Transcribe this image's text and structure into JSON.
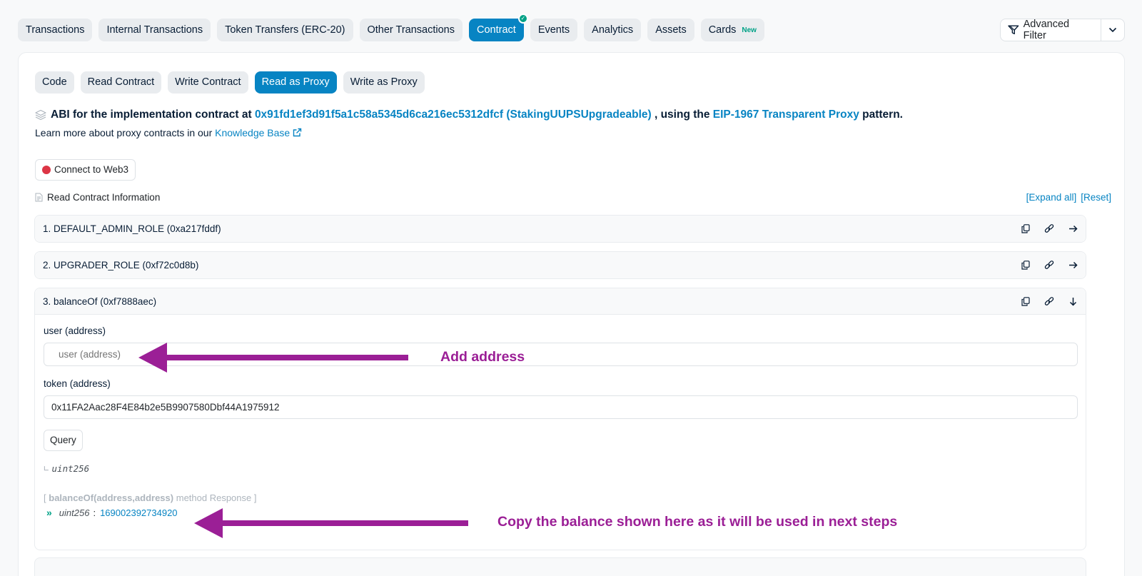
{
  "top_tabs": [
    {
      "label": "Transactions"
    },
    {
      "label": "Internal Transactions"
    },
    {
      "label": "Token Transfers (ERC-20)"
    },
    {
      "label": "Other Transactions"
    },
    {
      "label": "Contract"
    },
    {
      "label": "Events"
    },
    {
      "label": "Analytics"
    },
    {
      "label": "Assets"
    },
    {
      "label": "Cards",
      "badge": "New"
    }
  ],
  "advanced_filter": {
    "label": "Advanced Filter"
  },
  "sub_tabs": [
    {
      "label": "Code"
    },
    {
      "label": "Read Contract"
    },
    {
      "label": "Write Contract"
    },
    {
      "label": "Read as Proxy"
    },
    {
      "label": "Write as Proxy"
    }
  ],
  "abi": {
    "prefix": "ABI for the implementation contract at",
    "address_link": "0x91fd1ef3d91f5a1c58a5345d6ca216ec5312dfcf (StakingUUPSUpgradeable)",
    "middle": ", using the",
    "pattern_link": "EIP-1967 Transparent Proxy",
    "suffix": "pattern."
  },
  "learn": {
    "prefix": "Learn more about proxy contracts in our",
    "link": "Knowledge Base"
  },
  "connect_button": "Connect to Web3",
  "read_info_label": "Read Contract Information",
  "expand_all": "[Expand all]",
  "reset": "[Reset]",
  "functions": [
    {
      "title": "1. DEFAULT_ADMIN_ROLE (0xa217fddf)"
    },
    {
      "title": "2. UPGRADER_ROLE (0xf72c0d8b)"
    },
    {
      "title": "3. balanceOf (0xf7888aec)"
    }
  ],
  "balance_of": {
    "user_label": "user (address)",
    "user_placeholder": "user (address)",
    "token_label": "token (address)",
    "token_value": "0x11FA2Aac28F4E84b2e5B9907580Dbf44A1975912",
    "query_button": "Query",
    "return_type": "uint256",
    "response_prefix": "[",
    "response_method": "balanceOf(address,address)",
    "response_suffix": "method Response ]",
    "response_type": "uint256",
    "response_sep": ":",
    "response_value": "169002392734920"
  },
  "annotations": {
    "add_address": "Add address",
    "copy_balance": "Copy the balance shown here as it will be used in next steps",
    "color": "#9b1f96"
  },
  "colors": {
    "accent": "#0784c3",
    "success": "#00a186",
    "danger": "#dc3545"
  }
}
